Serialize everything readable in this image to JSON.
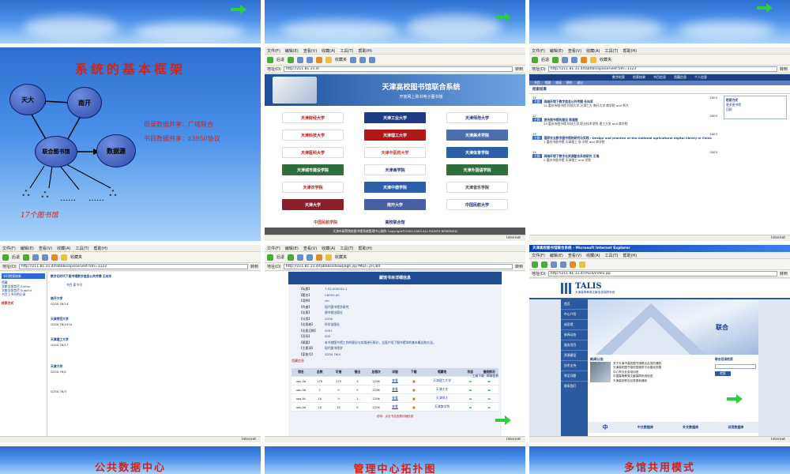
{
  "colors": {
    "sky": "#4a90e8",
    "red_title": "#d2231a",
    "green_arrow": "#2ecc40",
    "nav_blue": "#2c5aa0"
  },
  "slide1": {
    "arrow_icon": "green-arrow-icon"
  },
  "slide2": {
    "arrow_icon": "green-arrow-icon"
  },
  "slide3": {
    "arrow_icon": "green-arrow-icon"
  },
  "slide4": {
    "title": "系统的基本框架",
    "nodes": {
      "tianda": "天大",
      "nankai": "南开",
      "center": "联合图书馆",
      "db": "数据源"
    },
    "note1": "目录数据共享：广域联合",
    "note2": "书目数据共享：z3950协议",
    "dots1": "……",
    "dots2": "……",
    "libs": "17个图书馆"
  },
  "ie": {
    "menu": [
      "文件(F)",
      "编辑(E)",
      "查看(V)",
      "收藏(A)",
      "工具(T)",
      "帮助(H)"
    ],
    "back": "后退",
    "favorites": "收藏夹",
    "address_label": "地址(D)",
    "go": "转到",
    "internet": "Internet"
  },
  "slide5": {
    "url": "http://211.81.31.4/",
    "header_title": "天津高校图书馆联合系统",
    "header_sub": "开放网上购书电子图书馆",
    "logos": [
      "天津财经大学",
      "天津工业大学",
      "天津师范大学",
      "天津科技大学",
      "天津理工大学",
      "天津美术学院",
      "天津医科大学",
      "天津中医药大学",
      "天津体育学院",
      "天津城市建设学院",
      "天津商学院",
      "天津外国语学院",
      "天津农学院",
      "天津中德学院",
      "天津音乐学院",
      "天津大学",
      "南开大学",
      "中国民航大学"
    ],
    "last_logo": "中国民航学院",
    "system_name": "高校联合馆",
    "footer": "天津市高等院校图书馆系统管理中心制作 Copyright©2002-2003 ALL RIGHTS RESERVED"
  },
  "slide6": {
    "url": "http://211.81.31.4/tabhbs/opisservlet?zm=1123",
    "nav_tabs": [
      "数字检索",
      "检索结果",
      "书目信息",
      "馆藏信息",
      "个人信息"
    ],
    "subnav": [
      "书目",
      "馆藏",
      "借阅",
      "预约",
      "退出"
    ],
    "results_label": "检索结果",
    "results": [
      {
        "no": "11",
        "year": "2003",
        "title": "网络环境下数字信息公共传播 任向军",
        "info": "24 重庆市图书馆 科技大学 天津工大 南开大学 商学院 and 师大"
      },
      {
        "no": "12",
        "year": "2003",
        "title": "复合图书馆的建设 陈建智",
        "info": "29 重庆市图书馆 科技大学 职业技术学院 理工大学 and 商学院"
      },
      {
        "no": "13",
        "year": "2003",
        "title": "国家农业数字图书馆的研究与实践 - Design and practice of the national agricultural digital library in China",
        "info": "1 重庆市图书馆 天津理工 张 学院 and 商学院"
      },
      {
        "no": "14",
        "year": "2003",
        "title": "网络环境下数字化资源整合系统研究 王瑞",
        "info": "2 重庆市图书馆 天津理工 and 学院"
      }
    ],
    "side_title": "检索方式",
    "side_links": [
      "更多图书馆",
      "回顾"
    ],
    "badge": "主题"
  },
  "slide7": {
    "url": "http://211.81.31.4/tabhbs/opisservlet?zm=1122",
    "left_title": "书刊检索结果",
    "left_links": [
      "馆藏",
      "文献全部类目 Author",
      "文献全部类目 Subject",
      "书目上书刊的记录"
    ],
    "left_sub": "检索方式",
    "heading": "数字化时代下图书馆数字信息公共传播 王向东",
    "sub": "书目 索书号",
    "calls": [
      "G250.76/14",
      "G250.76/2410",
      "G250.76/17",
      "G250.76/2",
      "G250.76/3"
    ],
    "sections": [
      "南开大学",
      "天津师范大学",
      "天津理工大学",
      "天津大学"
    ]
  },
  "slide8": {
    "url": "http://211.81.31.4/tabhbs/showpage.jsp?MID=2FCB4",
    "panel_title": "藏馆书目详细信息",
    "fields": [
      {
        "k": "【标题】",
        "v": "7-02-000041-1"
      },
      {
        "k": "【题名】",
        "v": "CNY50.00"
      },
      {
        "k": "【语种】",
        "v": "chi"
      },
      {
        "k": "【作者】",
        "v": "现代图书馆学研究"
      },
      {
        "k": "【出版】",
        "v": "图书馆出版社"
      },
      {
        "k": "【分类】",
        "v": "G250"
      },
      {
        "k": "【出版者】",
        "v": "科学出版社"
      },
      {
        "k": "【出版日期】",
        "v": "2001"
      },
      {
        "k": "【页码】",
        "v": "200"
      },
      {
        "k": "【摘要】",
        "v": "本书就图书馆工作的理论与实践进行探讨，全面介绍了图书馆学的基本概念和方法。"
      },
      {
        "k": "【主题词】",
        "v": "现代图书馆学"
      },
      {
        "k": "【索取号】",
        "v": "G250.76/4"
      }
    ],
    "holdings_label": "馆藏信息",
    "holdings_right": [
      "工具下载",
      "帮助信息"
    ],
    "cols": [
      "馆名",
      "总数",
      "可借",
      "借出",
      "总借次",
      "详细",
      "下载",
      "馆藏地",
      "状态",
      "借阅情况"
    ],
    "rows": [
      [
        "uas-0a",
        "175",
        "175",
        "3",
        "229k",
        "查看",
        "",
        "天津理工大学",
        "",
        ""
      ],
      [
        "uas-0b",
        "2",
        "0",
        "2",
        "229k",
        "查看",
        "",
        "天津大学",
        "",
        ""
      ],
      [
        "uas-0c",
        "10",
        "9",
        "1",
        "229k",
        "查看",
        "",
        "天津师大",
        "",
        ""
      ],
      [
        "uas-0d",
        "10",
        "10",
        "0",
        "229k",
        "查看",
        "",
        "天津商学院",
        "",
        ""
      ]
    ],
    "footer": "说明：点击书名查看详细信息"
  },
  "slide9": {
    "win_title": "天津高校图书馆联合系统 - Microsoft Internet Explorer",
    "url": "http://211.81.31.4/TALIS/index.jsp",
    "brand": "TALIS",
    "brand_sub": "天津高等教育文献信息保障系统",
    "nav": [
      "首页",
      "中心介绍",
      "成员馆",
      "新闻动态",
      "服务项目",
      "资源建设",
      "技术支持",
      "常见问题",
      "联系我们"
    ],
    "hero_text": "联合",
    "news_title": "新闻公告",
    "news": [
      "关于天津市高校图书馆联合目录的通知",
      "天津高校图书馆信息服务平台建设进展",
      "中心举办业务培训班",
      "中国高等教育文献保障系统信息",
      "天津高校联合目录更新通知"
    ],
    "search_title": "联合目录检索",
    "search_btn": "检索",
    "bottom_tabs": [
      "中",
      "中文数据库",
      "外文数据库",
      "试用数据库"
    ]
  },
  "slide10": {
    "title": "公共数据中心"
  },
  "slide11": {
    "title": "管理中心拓扑图"
  },
  "slide12": {
    "title": "多馆共用模式"
  }
}
